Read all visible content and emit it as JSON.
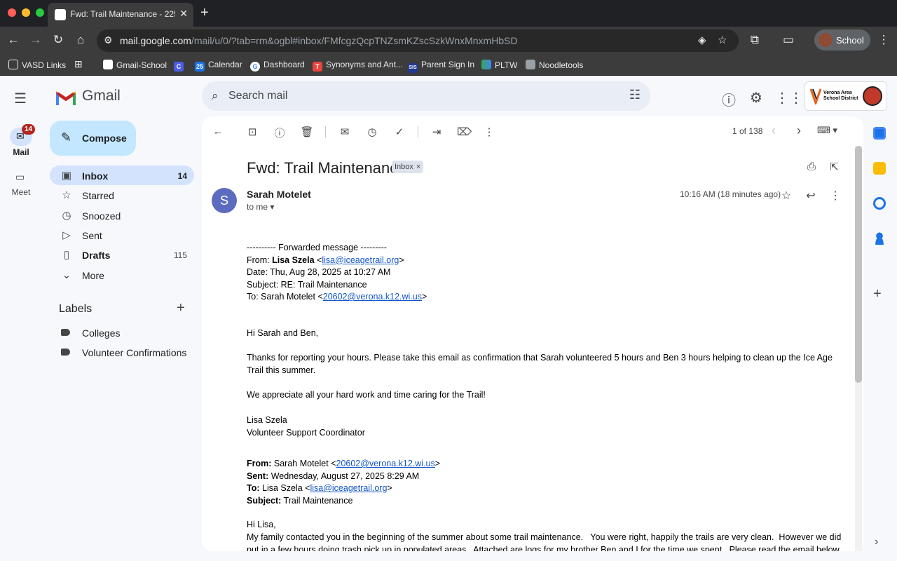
{
  "browser": {
    "tab_title": "Fwd: Trail Maintenance - 225",
    "url_host": "mail.google.com",
    "url_path": "/mail/u/0/?tab=rm&ogbl#inbox/FMfcgzQcpTNZsmKZscSzkWnxMnxmHbSD",
    "profile_name": "School",
    "bookmarks": [
      "VASD Links",
      "Gmail-School",
      "Calendar",
      "Dashboard",
      "Synonyms and Ant...",
      "Parent Sign In",
      "PLTW",
      "Noodletools"
    ],
    "bookmark_badges": [
      "C",
      "25",
      "G",
      "T",
      "SIS"
    ]
  },
  "gmail": {
    "logo_text": "Gmail",
    "search_placeholder": "Search mail",
    "district_name": "Verona Area School District"
  },
  "rail": {
    "mail_label": "Mail",
    "mail_badge": "14",
    "meet_label": "Meet"
  },
  "compose_label": "Compose",
  "nav": [
    {
      "label": "Inbox",
      "count": "14"
    },
    {
      "label": "Starred",
      "count": ""
    },
    {
      "label": "Snoozed",
      "count": ""
    },
    {
      "label": "Sent",
      "count": ""
    },
    {
      "label": "Drafts",
      "count": "115"
    },
    {
      "label": "More",
      "count": ""
    }
  ],
  "labels_heading": "Labels",
  "labels": [
    "Colleges",
    "Volunteer Confirmations"
  ],
  "pager": {
    "text": "1 of 138"
  },
  "message": {
    "subject": "Fwd: Trail Maintenance",
    "chip": "Inbox",
    "avatar_initial": "S",
    "sender": "Sarah Motelet",
    "to": "to me",
    "timestamp": "10:16 AM (18 minutes ago)",
    "forward_header": "---------- Forwarded message ---------",
    "from_prefix": "From: ",
    "from_name": "Lisa Szela",
    "from_email": "lisa@iceagetrail.org",
    "date_line": "Date: Thu, Aug 28, 2025 at 10:27 AM",
    "subject_line": "Subject: RE: Trail Maintenance",
    "to_prefix": "To: Sarah Motelet <",
    "to_email": "20602@verona.k12.wi.us",
    "greeting": "Hi Sarah and Ben,",
    "para1": "Thanks for reporting your hours. Please take this email as confirmation that Sarah volunteered 5 hours and Ben 3 hours helping to clean up the Ice Age Trail this summer.",
    "para2": "We appreciate all your hard work and time caring for the Trail!",
    "sig_name": "Lisa Szela",
    "sig_title": "Volunteer Support Coordinator",
    "q_from_label": "From:",
    "q_from_text": " Sarah Motelet <",
    "q_from_email": "20602@verona.k12.wi.us",
    "q_sent_label": "Sent:",
    "q_sent_text": " Wednesday, August 27, 2025 8:29 AM",
    "q_to_label": "To:",
    "q_to_text": " Lisa Szela <",
    "q_to_email": "lisa@iceagetrail.org",
    "q_subject_label": "Subject:",
    "q_subject_text": " Trail Maintenance",
    "q_greeting": "Hi Lisa,",
    "q_para": "My family contacted you in the beginning of the summer about some trail maintenance.   You were right, happily the trails are very clean.  However we did put in a few hours doing trash pick up in populated areas.  Attached are logs for my brother Ben and I for the time we spent.  Please read the email below and confirm when you"
  },
  "colors": {
    "accent": "#0b57d0",
    "nav_active": "#d3e3fd",
    "compose_bg": "#c2e7ff",
    "badge": "#b3261e",
    "avatar": "#5c6bc0",
    "link": "#1155cc"
  }
}
